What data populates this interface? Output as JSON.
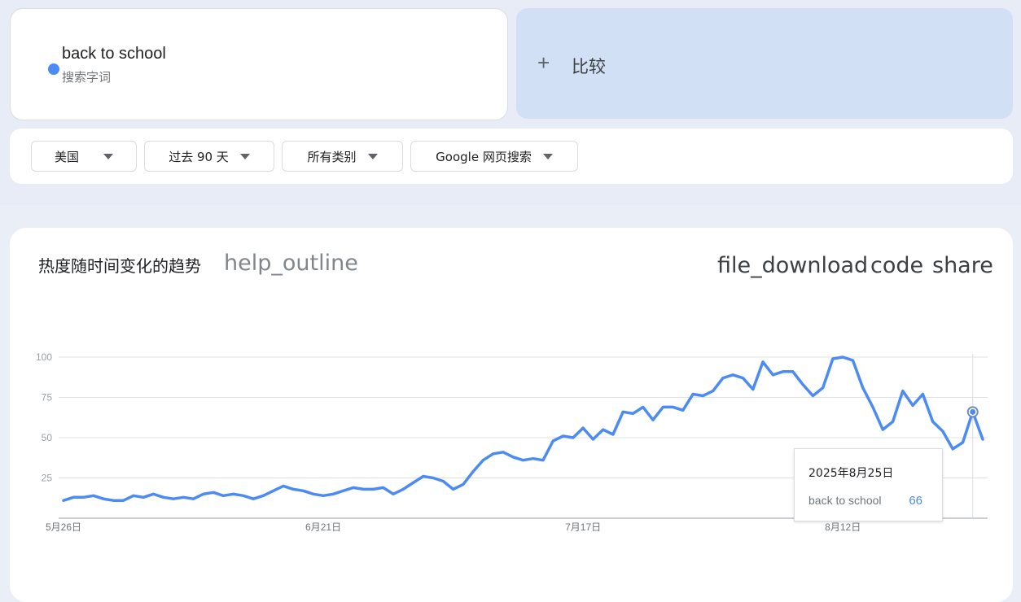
{
  "search": {
    "term": "back to school",
    "term_type": "搜索字词",
    "term_color": "#4c8bf5"
  },
  "compare": {
    "plus": "+",
    "label": "比较"
  },
  "filters": {
    "region": "美国",
    "time": "过去 90 天",
    "category": "所有类别",
    "property": "Google 网页搜索"
  },
  "chart_card": {
    "title": "热度随时间变化的趋势",
    "help_icon": "help_outline",
    "download_icon": "file_download",
    "code_icon": "code",
    "share_icon": "share"
  },
  "chart_data": {
    "type": "line",
    "title": "",
    "xlabel": "",
    "ylabel": "",
    "ylim": [
      0,
      100
    ],
    "yticks": [
      25,
      50,
      75,
      100
    ],
    "x_tick_labels": [
      {
        "label": "5月26日",
        "index": 0
      },
      {
        "label": "6月21日",
        "index": 26
      },
      {
        "label": "7月17日",
        "index": 52
      },
      {
        "label": "8月12日",
        "index": 78
      }
    ],
    "color": "#4c8bf5",
    "series": [
      {
        "name": "back to school",
        "values": [
          11,
          13,
          13,
          14,
          12,
          11,
          11,
          14,
          13,
          15,
          13,
          12,
          13,
          12,
          15,
          16,
          14,
          15,
          14,
          12,
          14,
          17,
          20,
          18,
          17,
          15,
          14,
          15,
          17,
          19,
          18,
          18,
          19,
          15,
          18,
          22,
          26,
          25,
          23,
          18,
          21,
          29,
          36,
          40,
          41,
          38,
          36,
          37,
          36,
          48,
          51,
          50,
          56,
          49,
          55,
          52,
          66,
          65,
          69,
          61,
          69,
          69,
          67,
          77,
          76,
          79,
          87,
          89,
          87,
          80,
          97,
          89,
          91,
          91,
          83,
          76,
          81,
          99,
          100,
          98,
          81,
          69,
          55,
          60,
          79,
          70,
          77,
          60,
          54,
          43,
          47,
          66,
          49
        ]
      }
    ],
    "highlight": {
      "index": 91,
      "date": "2025年8月25日",
      "value": "66"
    }
  }
}
